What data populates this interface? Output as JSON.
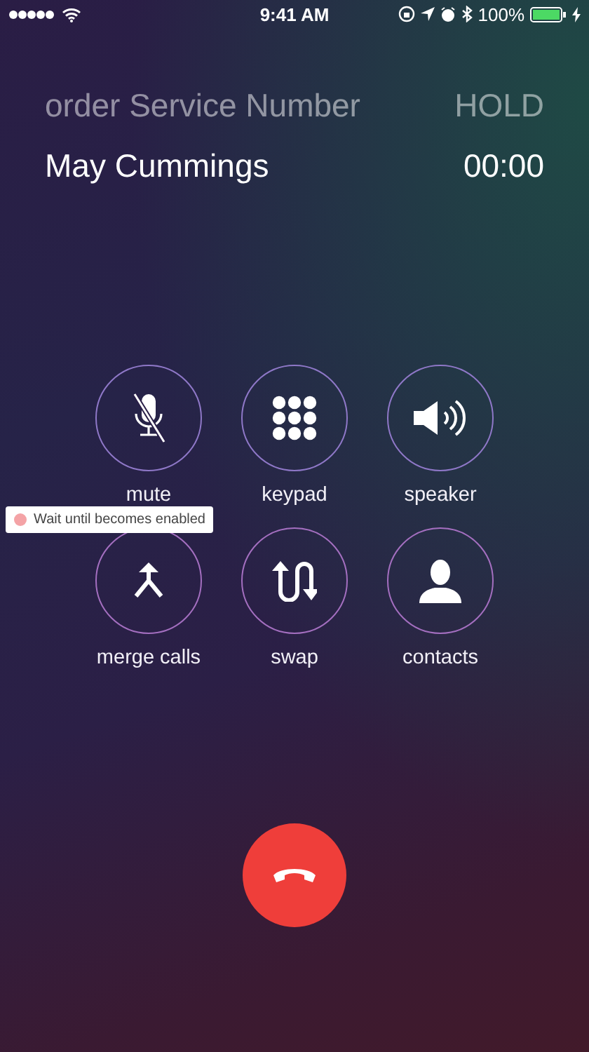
{
  "status_bar": {
    "time": "9:41 AM",
    "battery": "100%"
  },
  "calls": [
    {
      "name": "order Service Number",
      "status": "HOLD",
      "held": true
    },
    {
      "name": "May Cummings",
      "status": "00:00",
      "held": false
    }
  ],
  "buttons": [
    {
      "kind": "mute",
      "label": "mute"
    },
    {
      "kind": "keypad",
      "label": "keypad"
    },
    {
      "kind": "speaker",
      "label": "speaker"
    },
    {
      "kind": "merge",
      "label": "merge calls"
    },
    {
      "kind": "swap",
      "label": "swap"
    },
    {
      "kind": "contacts",
      "label": "contacts"
    }
  ],
  "tooltip": {
    "text": "Wait until becomes enabled"
  }
}
